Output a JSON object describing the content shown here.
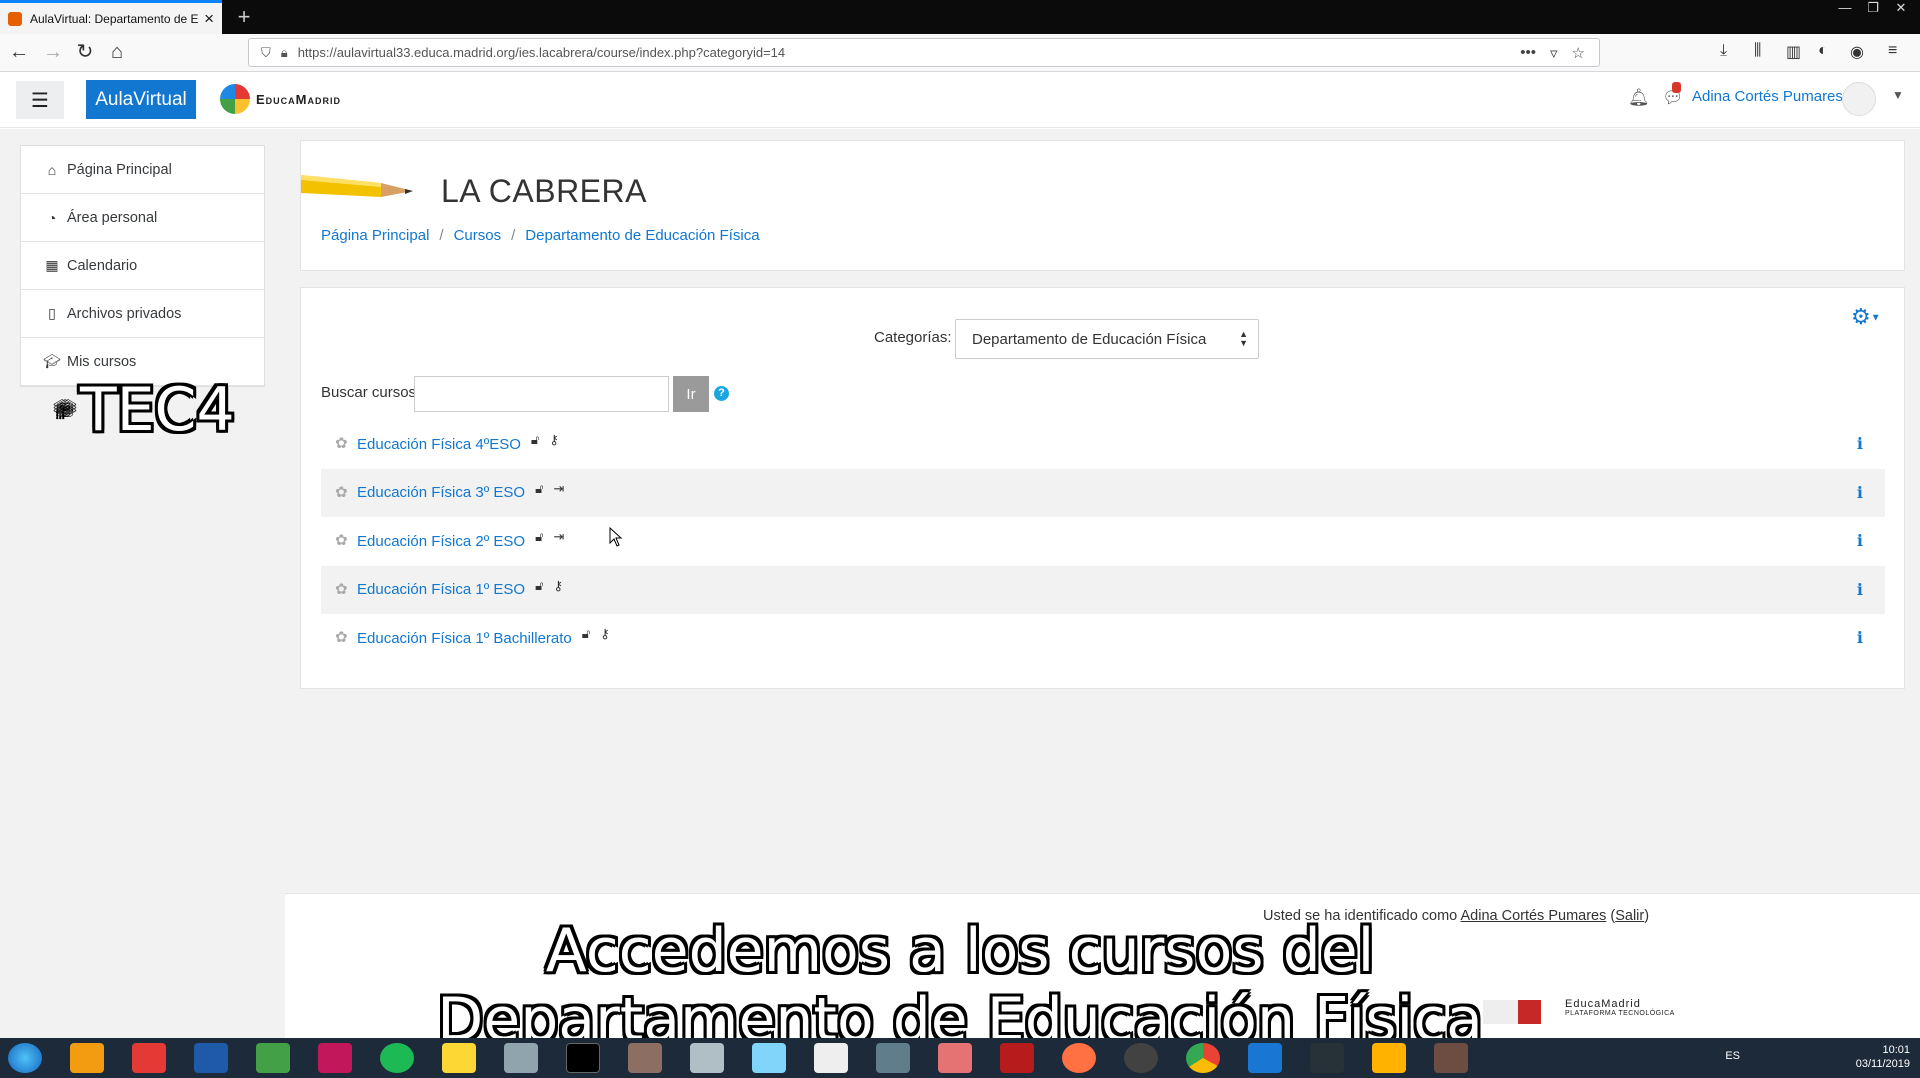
{
  "browser": {
    "tab_title": "AulaVirtual: Departamento de E",
    "url": "https://aulavirtual33.educa.madrid.org/ies.lacabrera/course/index.php?categoryid=14",
    "url_more": "•••"
  },
  "header": {
    "brand": "AulaVirtual",
    "logo_text": "EducaMadrid",
    "user_name": "Adina Cortés Pumares",
    "message_count": "1"
  },
  "nav": {
    "items": [
      {
        "label": "Página Principal",
        "icon": "home-icon"
      },
      {
        "label": "Área personal",
        "icon": "dashboard-icon"
      },
      {
        "label": "Calendario",
        "icon": "calendar-icon"
      },
      {
        "label": "Archivos privados",
        "icon": "file-icon"
      },
      {
        "label": "Mis cursos",
        "icon": "graduation-cap-icon"
      }
    ],
    "courses": [
      {
        "label": "TEC4",
        "icon": "graduation-cap-icon"
      }
    ]
  },
  "page": {
    "title": "LA CABRERA",
    "breadcrumb": [
      "Página Principal",
      "Cursos",
      "Departamento de Educación Física"
    ]
  },
  "content": {
    "category_label": "Categorías:",
    "category_selected": "Departamento de Educación Física",
    "search_label": "Buscar cursos",
    "search_button": "Ir",
    "courses": [
      {
        "name": "Educación Física 4ºESO",
        "access": "key-icon"
      },
      {
        "name": "Educación Física 3º ESO",
        "access": "login-icon"
      },
      {
        "name": "Educación Física 2º ESO",
        "access": "login-icon"
      },
      {
        "name": "Educación Física 1º ESO",
        "access": "key-icon"
      },
      {
        "name": "Educación Física 1º Bachillerato",
        "access": "key-icon"
      }
    ]
  },
  "footer": {
    "logged_prefix": "Usted se ha identificado como",
    "logged_user": "Adina Cortés Pumares",
    "logout": "Salir",
    "logo_text": "EducaMadrid",
    "logo_sub": "PLATAFORMA TECNOLÓGICA"
  },
  "subtitles": {
    "line1": "Accedemos a los cursos del",
    "line2": "Departamento de Educación Física"
  },
  "taskbar": {
    "lang": "ES",
    "time": "10:01",
    "date": "03/11/2019"
  }
}
